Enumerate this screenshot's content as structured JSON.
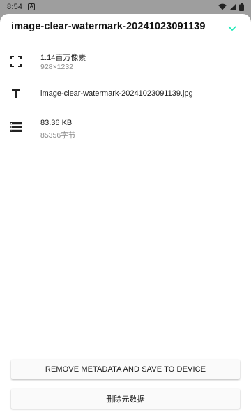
{
  "status_bar": {
    "time": "8:54",
    "notification_icon": "A",
    "icons": [
      "wifi-icon",
      "signal-icon",
      "battery-icon"
    ]
  },
  "header": {
    "title": "image-clear-watermark-20241023091139",
    "collapse_icon": "chevron-down-icon"
  },
  "details": {
    "resolution": {
      "icon": "fullscreen-corners-icon",
      "megapixels": "1.14百万像素",
      "dimensions": "928×1232"
    },
    "filename": {
      "icon": "text-title-icon",
      "name": "image-clear-watermark-20241023091139.jpg"
    },
    "size": {
      "icon": "storage-list-icon",
      "size_kb": "83.36 KB",
      "size_bytes": "85356字节"
    }
  },
  "actions": {
    "remove_and_save": "REMOVE METADATA AND SAVE TO DEVICE",
    "delete_metadata": "删除元数据"
  },
  "colors": {
    "accent": "#1de9b6",
    "scrim": "#9e9e9e",
    "sheet": "#ffffff"
  }
}
